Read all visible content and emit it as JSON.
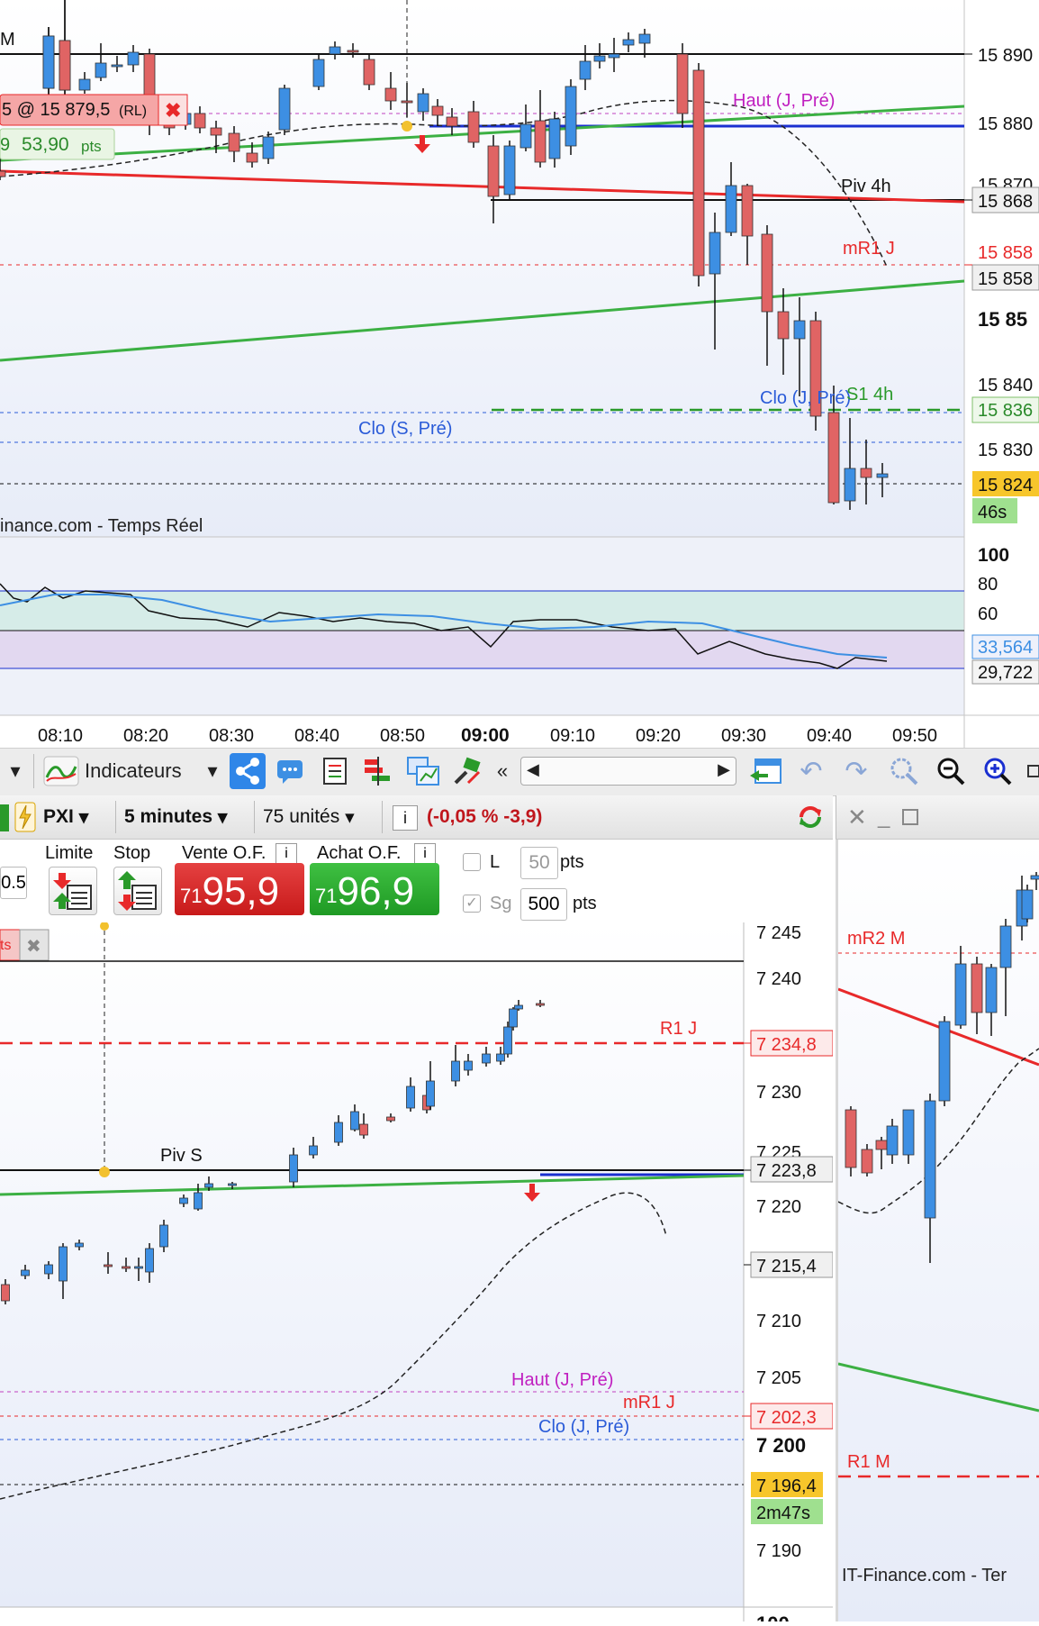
{
  "top_chart": {
    "left_label": "M",
    "axis_prices": [
      "15 890",
      "15 880",
      "15 870",
      "15 868",
      "15 858",
      "15 858",
      "15 85",
      "15 840",
      "15 836",
      "15 830",
      "15 824"
    ],
    "countdown": "46s",
    "order_badge": "5 @ 15 879,5",
    "order_badge_suffix": "(RL)",
    "pts_badge_prefix": "9",
    "pts_badge_value": "53,90",
    "pts_badge_unit": "pts",
    "labels": {
      "haut": "Haut (J, Pré)",
      "piv4h": "Piv 4h",
      "mr1j": "mR1 J",
      "clo_j": "Clo (J, Pré)",
      "s1_4h": "S1 4h",
      "clo_s": "Clo (S, Pré)"
    },
    "watermark": "inance.com - Temps Réel",
    "indicator_axis": [
      "100",
      "80",
      "60",
      "33,564",
      "29,722"
    ],
    "time_labels": [
      "08:10",
      "08:20",
      "08:30",
      "08:40",
      "08:50",
      "09:00",
      "09:10",
      "09:20",
      "09:30",
      "09:40",
      "09:50"
    ]
  },
  "toolbar": {
    "indicators_label": "Indicateurs",
    "collapse_label": "«"
  },
  "trade_header": {
    "symbol": "PXI",
    "interval": "5 minutes",
    "units": "75 unités",
    "info_glyph": "i",
    "change": "(-0,05 % -3,9)"
  },
  "order_row": {
    "left_value": "0.5",
    "limit_label": "Limite",
    "stop_label": "Stop",
    "sell_label": "Vente O.F.",
    "buy_label": "Achat O.F.",
    "info_glyph": "i",
    "sell_prefix": "71",
    "sell_price": "95,9",
    "buy_prefix": "71",
    "buy_price": "96,9",
    "l_label": "L",
    "l_value": "50",
    "l_unit": "pts",
    "sg_label": "Sg",
    "sg_value": "500",
    "sg_unit": "pts",
    "tag_text": "ts"
  },
  "bottom_chart": {
    "axis_prices": [
      "7 245",
      "7 240",
      "7 234,8",
      "7 230",
      "7 225",
      "7 223,8",
      "7 220",
      "7 215,4",
      "7 210",
      "7 205",
      "7 202,3",
      "7 200",
      "7 196,4",
      "7 190",
      "100"
    ],
    "countdown": "2m47s",
    "labels": {
      "r1j": "R1 J",
      "piv_s": "Piv S",
      "haut": "Haut (J, Pré)",
      "mr1j": "mR1 J",
      "clo_j": "Clo (J, Pré)"
    }
  },
  "right_chart": {
    "mr2m": "mR2 M",
    "r1m": "R1 M",
    "watermark": "IT-Finance.com - Ter"
  },
  "colors": {
    "bull": "#3d8fe3",
    "bear": "#e06464",
    "green_line": "#3cb043",
    "red_line": "#e8292a",
    "blue_line": "#1a2fd0"
  }
}
